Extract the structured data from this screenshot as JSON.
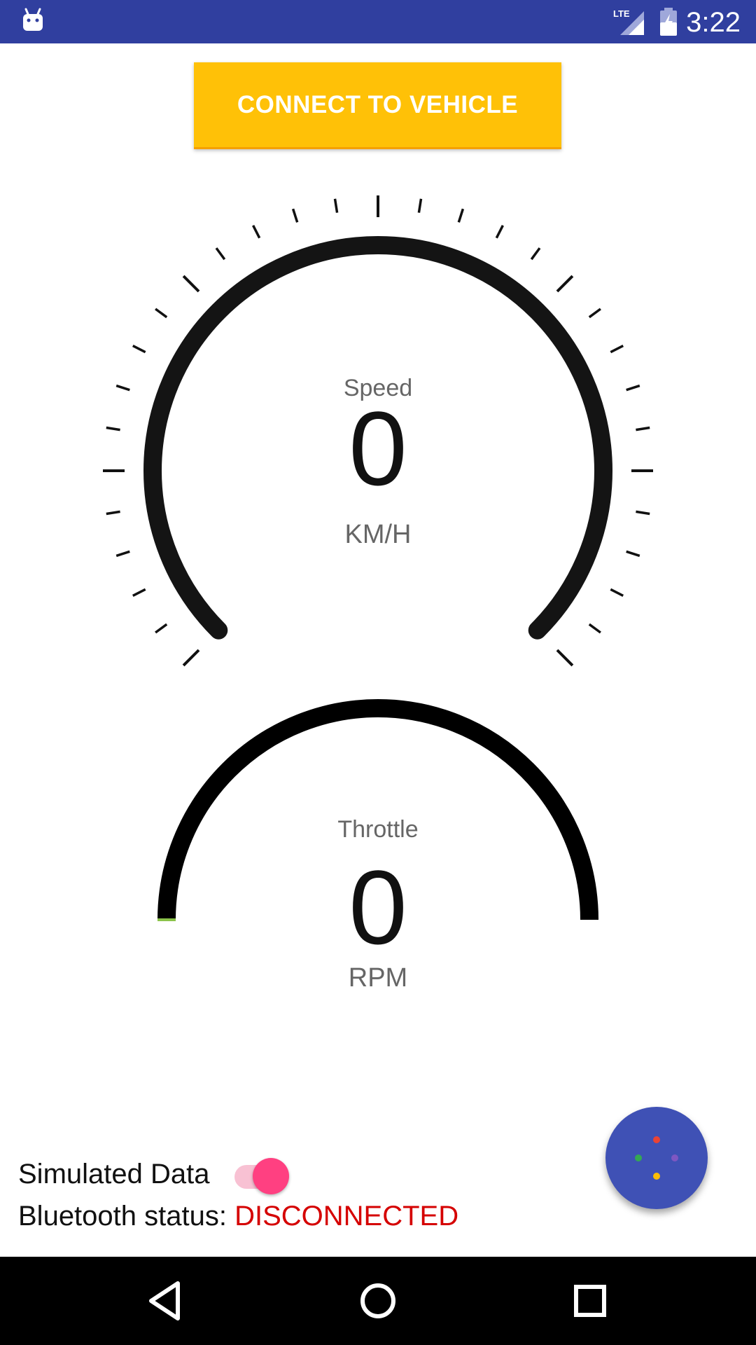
{
  "status_bar": {
    "time": "3:22",
    "network": "LTE"
  },
  "actions": {
    "connect_label": "CONNECT TO VEHICLE"
  },
  "speed_gauge": {
    "label": "Speed",
    "value": "0",
    "unit": "KM/H",
    "fraction": 0
  },
  "throttle_gauge": {
    "label": "Throttle",
    "value": "0",
    "unit": "RPM",
    "fraction": 0
  },
  "controls": {
    "simulated_label": "Simulated Data",
    "simulated_on": true,
    "bluetooth_label": "Bluetooth status: ",
    "bluetooth_status": "DISCONNECTED"
  },
  "colors": {
    "status_bar": "#303F9F",
    "connect_button": "#FFC107",
    "toggle_thumb": "#FF4081",
    "toggle_track": "#F8C1D3",
    "fab": "#3F51B5",
    "status_error": "#D50000",
    "throttle_start_marker": "#8BC34A"
  },
  "icons": {
    "status_left": "android-debug-icon",
    "signal": "lte-signal-icon",
    "battery": "battery-charging-icon",
    "fab": "google-assistant-dots-icon",
    "nav_back": "back-triangle-icon",
    "nav_home": "home-circle-icon",
    "nav_recents": "recents-square-icon"
  }
}
